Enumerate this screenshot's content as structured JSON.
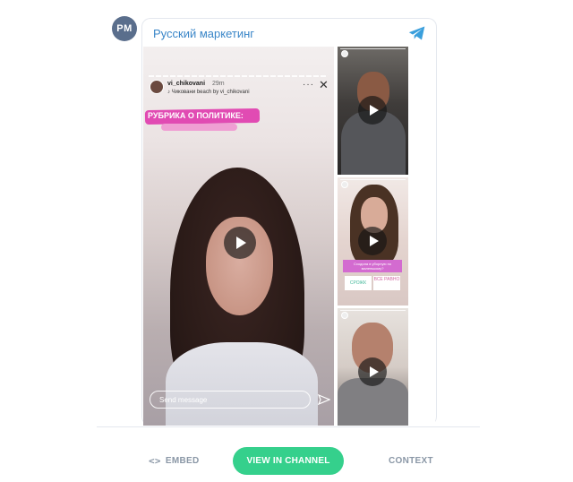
{
  "channel": {
    "avatar_initials": "PM",
    "title": "Русский маркетинг",
    "accent": "#3a86c8"
  },
  "story": {
    "username": "vi_chikovani",
    "time": "29m",
    "music": "♪ Чиковани beach by vi_chikovani",
    "more": "···",
    "close": "✕",
    "caption": "РУБРИКА О ПОЛИТИКЕ:",
    "send_placeholder": "Send message"
  },
  "thumbs": [
    {
      "poll": null
    },
    {
      "poll": {
        "question": "Сходила в уборную по маленькому?",
        "option_a": "СРОЖК",
        "option_b": "ВСЕ РАВНО"
      }
    },
    {
      "poll": null
    }
  ],
  "footer": {
    "embed_icon": "<>",
    "embed_label": "EMBED",
    "view_label": "VIEW IN CHANNEL",
    "view_color": "#35d08c",
    "context_label": "CONTEXT"
  }
}
